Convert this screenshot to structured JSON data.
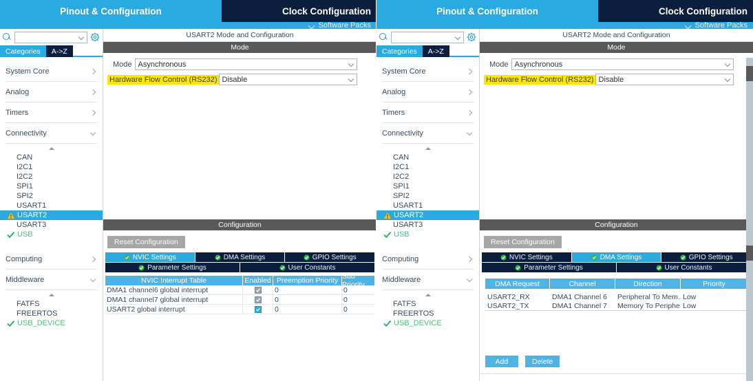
{
  "header": {
    "tab_pinout": "Pinout & Configuration",
    "tab_clock": "Clock Configuration",
    "software_packs": "Software Packs",
    "chevron_icon": "chevron-down-icon",
    "accent_blue": "#29ABE2",
    "navy": "#0C1E3E"
  },
  "sidebar": {
    "search_placeholder": "",
    "search_value": "",
    "search_icon": "search-icon",
    "gear_icon": "gear-icon",
    "tab_categories": "Categories",
    "tab_az": "A->Z",
    "groups": [
      {
        "label": "System Core",
        "state": "collapsed"
      },
      {
        "label": "Analog",
        "state": "collapsed"
      },
      {
        "label": "Timers",
        "state": "collapsed"
      },
      {
        "label": "Connectivity",
        "state": "expanded"
      }
    ],
    "connectivity_items": [
      {
        "label": "CAN",
        "status": "none",
        "selected": false
      },
      {
        "label": "I2C1",
        "status": "none",
        "selected": false
      },
      {
        "label": "I2C2",
        "status": "none",
        "selected": false
      },
      {
        "label": "SPI1",
        "status": "none",
        "selected": false
      },
      {
        "label": "SPI2",
        "status": "none",
        "selected": false
      },
      {
        "label": "USART1",
        "status": "none",
        "selected": false
      },
      {
        "label": "USART2",
        "status": "warning",
        "selected": true
      },
      {
        "label": "USART3",
        "status": "none",
        "selected": false
      },
      {
        "label": "USB",
        "status": "ok",
        "selected": false
      }
    ],
    "groups2": [
      {
        "label": "Computing",
        "state": "collapsed"
      },
      {
        "label": "Middleware",
        "state": "expanded"
      }
    ],
    "middleware_items": [
      {
        "label": "FATFS",
        "status": "none",
        "selected": false
      },
      {
        "label": "FREERTOS",
        "status": "none",
        "selected": false
      },
      {
        "label": "USB_DEVICE",
        "status": "ok",
        "selected": false
      }
    ],
    "warning_icon": "warning-triangle-icon",
    "check_icon": "check-icon",
    "ok_color": "#4CC07A",
    "warn_color": "#FFC425"
  },
  "mode_panel": {
    "title": "USART2 Mode and Configuration",
    "section_header": "Mode",
    "fields": [
      {
        "label": "Mode",
        "value": "Asynchronous",
        "highlighted": false
      },
      {
        "label": "Hardware Flow Control (RS232)",
        "value": "Disable",
        "highlighted": true
      }
    ],
    "highlight_color": "#FFE600",
    "dropdown_icon": "chevron-down-icon"
  },
  "config_panel": {
    "section_header": "Configuration",
    "reset_button": "Reset Configuration",
    "tabs_row1": [
      {
        "label": "NVIC Settings",
        "icon": "check-circle-icon"
      },
      {
        "label": "DMA Settings",
        "icon": "check-circle-icon"
      },
      {
        "label": "GPIO Settings",
        "icon": "check-circle-icon"
      }
    ],
    "tabs_row2": [
      {
        "label": "Parameter Settings",
        "icon": "check-circle-icon"
      },
      {
        "label": "User Constants",
        "icon": "check-circle-icon"
      }
    ],
    "selected_left": "NVIC Settings",
    "selected_right": "DMA Settings"
  },
  "nvic_table": {
    "columns": [
      "NVIC Interrupt Table",
      "Enabled",
      "Preemption Priority",
      "Sub Priority"
    ],
    "rows": [
      {
        "name": "DMA1 channel6 global interrupt",
        "enabled": true,
        "enabled_locked": true,
        "preemption": "0",
        "sub": "0"
      },
      {
        "name": "DMA1 channel7 global interrupt",
        "enabled": true,
        "enabled_locked": true,
        "preemption": "0",
        "sub": "0"
      },
      {
        "name": "USART2 global interrupt",
        "enabled": true,
        "enabled_locked": false,
        "preemption": "0",
        "sub": "0"
      }
    ]
  },
  "dma_table": {
    "columns": [
      "DMA Request",
      "Channel",
      "Direction",
      "Priority"
    ],
    "rows": [
      {
        "request": "USART2_RX",
        "channel": "DMA1 Channel 6",
        "direction": "Peripheral To Mem...",
        "priority": "Low"
      },
      {
        "request": "USART2_TX",
        "channel": "DMA1 Channel 7",
        "direction": "Memory To Periphe...",
        "priority": "Low"
      }
    ],
    "add_button": "Add",
    "delete_button": "Delete"
  }
}
